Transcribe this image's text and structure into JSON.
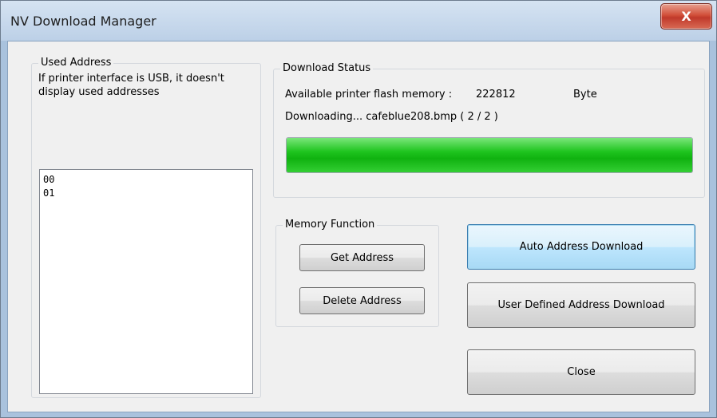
{
  "window": {
    "title": "NV Download Manager",
    "close_glyph": "X"
  },
  "used_address": {
    "label": "Used Address",
    "note": "If printer interface is USB, it doesn't display used addresses",
    "items": [
      "00",
      "01"
    ]
  },
  "download_status": {
    "label": "Download Status",
    "memory_label": "Available printer flash memory :",
    "memory_value": "222812",
    "memory_unit": "Byte",
    "progress_text": "Downloading... cafeblue208.bmp ( 2 / 2 )",
    "progress_fraction": 1.0,
    "progress_color": "#1ec41e"
  },
  "memory_function": {
    "label": "Memory Function",
    "get_address": "Get Address",
    "delete_address": "Delete Address"
  },
  "actions": {
    "auto_download": "Auto Address Download",
    "user_defined_download": "User Defined Address Download",
    "close": "Close"
  }
}
